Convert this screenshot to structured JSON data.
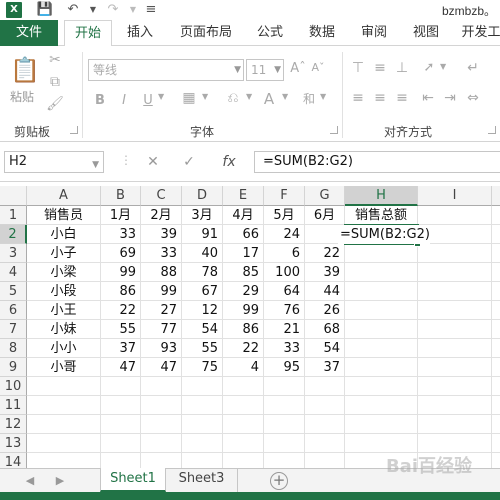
{
  "titlebar": {
    "app_icon": "excel-logo",
    "title": "bzmbzb。"
  },
  "tabs": [
    "文件",
    "开始",
    "插入",
    "页面布局",
    "公式",
    "数据",
    "审阅",
    "视图",
    "开发工"
  ],
  "ribbon": {
    "paste_label": "粘贴",
    "font_name": "等线",
    "font_size": "11",
    "groups": {
      "clipboard": "剪贴板",
      "font": "字体",
      "alignment": "对齐方式"
    },
    "format_buttons": [
      "B",
      "I",
      "U"
    ]
  },
  "formula_bar": {
    "name_box": "H2",
    "cancel": "✕",
    "enter": "✓",
    "fx": "fx",
    "formula": "=SUM(B2:G2)"
  },
  "grid": {
    "columns": [
      "A",
      "B",
      "C",
      "D",
      "E",
      "F",
      "G",
      "H",
      "I"
    ],
    "rows": [
      "1",
      "2",
      "3",
      "4",
      "5",
      "6",
      "7",
      "8",
      "9",
      "10",
      "11",
      "12",
      "13",
      "14"
    ],
    "header_row": [
      "销售员",
      "1月",
      "2月",
      "3月",
      "4月",
      "5月",
      "6月",
      "销售总额"
    ],
    "data": [
      [
        "小白",
        "33",
        "39",
        "91",
        "66",
        "24",
        ""
      ],
      [
        "小子",
        "69",
        "33",
        "40",
        "17",
        "6",
        "22"
      ],
      [
        "小梁",
        "99",
        "88",
        "78",
        "85",
        "100",
        "39"
      ],
      [
        "小段",
        "86",
        "99",
        "67",
        "29",
        "64",
        "44"
      ],
      [
        "小王",
        "22",
        "27",
        "12",
        "99",
        "76",
        "26"
      ],
      [
        "小妹",
        "55",
        "77",
        "54",
        "86",
        "21",
        "68"
      ],
      [
        "小小",
        "37",
        "93",
        "55",
        "22",
        "33",
        "54"
      ],
      [
        "小哥",
        "47",
        "47",
        "75",
        "4",
        "95",
        "37"
      ]
    ],
    "active_cell": "H2",
    "active_cell_text": "=SUM(B2:G2)"
  },
  "sheets": {
    "tabs": [
      "Sheet1",
      "Sheet3"
    ],
    "active": "Sheet1",
    "add": "+"
  },
  "watermark": "Bai百经验",
  "colors": {
    "accent": "#217346",
    "header_bg": "#f3f3f3"
  }
}
